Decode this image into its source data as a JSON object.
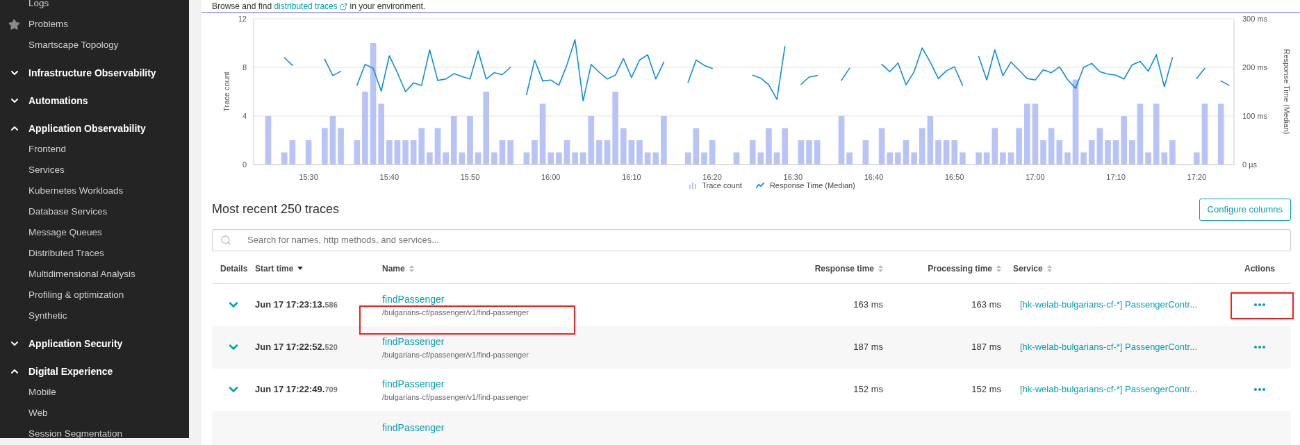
{
  "sidebar": {
    "items": [
      {
        "kind": "link",
        "label": "Logs"
      },
      {
        "kind": "pinned",
        "label": "Problems"
      },
      {
        "kind": "link",
        "label": "Smartscape Topology"
      },
      {
        "kind": "section",
        "label": "Infrastructure Observability",
        "expanded": false
      },
      {
        "kind": "section",
        "label": "Automations",
        "expanded": false
      },
      {
        "kind": "section",
        "label": "Application Observability",
        "expanded": true,
        "children": [
          "Frontend",
          "Services",
          "Kubernetes Workloads",
          "Database Services",
          "Message Queues",
          "Distributed Traces",
          "Multidimensional Analysis",
          "Profiling & optimization",
          "Synthetic"
        ]
      },
      {
        "kind": "section",
        "label": "Application Security",
        "expanded": false
      },
      {
        "kind": "section",
        "label": "Digital Experience",
        "expanded": true,
        "children": [
          "Mobile",
          "Web",
          "Session Segmentation"
        ]
      }
    ]
  },
  "intro": {
    "before": "Browse and find",
    "link": "distributed traces",
    "after": "in your environment."
  },
  "trace_count": {
    "chart_data": {
      "type": "bar",
      "ylabel": "Trace count",
      "ylim": [
        0,
        12
      ],
      "yticks": [
        0,
        4,
        8,
        12
      ],
      "categories": [
        null,
        null,
        null,
        null,
        null,
        "15:30",
        null,
        null,
        null,
        null,
        null,
        null,
        null,
        null,
        null,
        "15:40",
        null,
        null,
        null,
        null,
        null,
        null,
        null,
        null,
        null,
        "15:50",
        null,
        null,
        null,
        null,
        null,
        null,
        null,
        null,
        null,
        "16:00",
        null,
        null,
        null,
        null,
        null,
        null,
        null,
        null,
        null,
        "16:10",
        null,
        null,
        null,
        null,
        null,
        null,
        null,
        null,
        null,
        "16:20",
        null,
        null,
        null,
        null,
        null,
        null,
        null,
        null,
        null,
        "16:30",
        null,
        null,
        null,
        null,
        null,
        null,
        null,
        null,
        null,
        "16:40",
        null,
        null,
        null,
        null,
        null,
        null,
        null,
        null,
        null,
        "16:50",
        null,
        null,
        null,
        null,
        null,
        null,
        null,
        null,
        null,
        "17:00",
        null,
        null,
        null,
        null,
        null,
        null,
        null,
        null,
        null,
        "17:10",
        null,
        null,
        null,
        null,
        null,
        null,
        null,
        null,
        null,
        "17:20",
        null,
        null,
        null,
        null
      ],
      "series": [
        {
          "name": "Trace count",
          "color": "#b8c3f8",
          "values": [
            4,
            null,
            1,
            2,
            null,
            2,
            null,
            3,
            4,
            3,
            null,
            2,
            6,
            10,
            5,
            2,
            2,
            2,
            2,
            3,
            1,
            3,
            1,
            4,
            1,
            4,
            1,
            6,
            1,
            2,
            2,
            null,
            1,
            2,
            5,
            1,
            1,
            2,
            1,
            1,
            4,
            2,
            2,
            6,
            3,
            2,
            2,
            1,
            1,
            4,
            null,
            null,
            1,
            3,
            1,
            2,
            null,
            null,
            1,
            null,
            2,
            1,
            3,
            1,
            3,
            null,
            2,
            2,
            2,
            null,
            null,
            4,
            1,
            null,
            2,
            null,
            3,
            1,
            1,
            2,
            1,
            3,
            4,
            2,
            2,
            2,
            1,
            null,
            1,
            1,
            3,
            1,
            1,
            3,
            5,
            5,
            2,
            3,
            2,
            1,
            7,
            1,
            2,
            3,
            2,
            2,
            4,
            2,
            5,
            1,
            5,
            1,
            2,
            null,
            null,
            1,
            5,
            null,
            5,
            null
          ]
        }
      ]
    }
  },
  "response_time": {
    "chart_data": {
      "type": "line",
      "ylabel": "Response Time (Median)",
      "ylim": [
        0,
        300
      ],
      "yticks": [
        {
          "value": 0,
          "label": "0 µs"
        },
        {
          "value": 100,
          "label": "100 ms"
        },
        {
          "value": 200,
          "label": "200 ms"
        },
        {
          "value": 300,
          "label": "300 ms"
        }
      ],
      "categories": [
        null,
        null,
        null,
        null,
        null,
        null,
        null,
        null,
        null,
        null,
        null,
        null,
        null,
        null,
        null,
        null,
        null,
        null,
        null,
        null,
        null,
        null,
        null,
        null,
        null,
        null,
        null,
        null,
        null,
        null,
        null,
        null,
        null,
        null,
        null,
        null,
        null,
        null,
        null,
        null,
        null,
        null,
        null,
        null,
        null,
        null,
        null,
        null,
        null,
        null,
        null,
        null,
        null,
        null,
        null,
        null,
        null,
        null,
        null,
        null,
        null,
        null,
        null,
        null,
        null,
        null,
        null,
        null,
        null,
        null,
        null,
        null,
        null,
        null,
        null,
        null,
        null,
        null,
        null,
        null,
        null,
        null,
        null,
        null,
        null,
        null,
        null,
        null,
        null,
        null,
        null,
        null,
        null,
        null,
        null,
        null,
        null,
        null,
        null,
        null,
        null,
        null,
        null,
        null,
        null,
        null,
        null,
        null,
        null,
        null,
        null,
        null,
        null,
        null,
        null,
        null,
        null,
        null,
        null,
        null
      ],
      "series": [
        {
          "name": "Response Time (Median)",
          "color": "#0b8fdc",
          "values": [
            null,
            null,
            220,
            204,
            null,
            null,
            null,
            217,
            183,
            192,
            null,
            163,
            206,
            198,
            151,
            224,
            189,
            150,
            168,
            163,
            236,
            173,
            176,
            187,
            181,
            176,
            234,
            176,
            189,
            185,
            200,
            null,
            144,
            215,
            172,
            174,
            163,
            205,
            257,
            131,
            206,
            190,
            176,
            184,
            218,
            179,
            215,
            226,
            176,
            211,
            null,
            null,
            169,
            215,
            204,
            198,
            null,
            null,
            null,
            null,
            184,
            178,
            164,
            134,
            243,
            null,
            165,
            180,
            183,
            null,
            null,
            173,
            198,
            null,
            null,
            null,
            206,
            191,
            209,
            164,
            191,
            240,
            211,
            177,
            193,
            201,
            163,
            null,
            222,
            174,
            236,
            183,
            211,
            194,
            177,
            174,
            195,
            189,
            201,
            175,
            157,
            200,
            208,
            191,
            186,
            184,
            176,
            205,
            212,
            192,
            226,
            160,
            220,
            null,
            null,
            177,
            198,
            null,
            172,
            163
          ]
        }
      ]
    }
  },
  "traces": {
    "title": "Most recent 250 traces",
    "configure_button": "Configure columns",
    "search": {
      "placeholder": "Search for names, http methods, and services..."
    },
    "columns": [
      {
        "label": "Details",
        "sortable": false
      },
      {
        "label": "Start time",
        "sortable": true,
        "sorted": true
      },
      {
        "label": "Name",
        "sortable": true,
        "sorted": false
      },
      {
        "label": "Response time",
        "sortable": true,
        "sorted": false
      },
      {
        "label": "Processing time",
        "sortable": true,
        "sorted": false
      },
      {
        "label": "Service",
        "sortable": true,
        "sorted": false
      },
      {
        "label": "Actions",
        "sortable": false
      }
    ],
    "rows": [
      {
        "kind": "full",
        "expanded": false,
        "highlighted": true,
        "start": "Jun 17 17:23:13.",
        "ms": "586",
        "name": "findPassenger",
        "path": "/bulgarians-cf/passenger/v1/find-passenger",
        "response": "163 ms",
        "processing": "163 ms",
        "service": "[hk-welab-bulgarians-cf-*] PassengerContr..."
      },
      {
        "kind": "full",
        "expanded": false,
        "highlighted": false,
        "start": "Jun 17 17:22:52.",
        "ms": "520",
        "name": "findPassenger",
        "path": "/bulgarians-cf/passenger/v1/find-passenger",
        "response": "187 ms",
        "processing": "187 ms",
        "service": "[hk-welab-bulgarians-cf-*] PassengerContr..."
      },
      {
        "kind": "full",
        "expanded": false,
        "highlighted": false,
        "start": "Jun 17 17:22:49.",
        "ms": "709",
        "name": "findPassenger",
        "path": "/bulgarians-cf/passenger/v1/find-passenger",
        "response": "152 ms",
        "processing": "152 ms",
        "service": "[hk-welab-bulgarians-cf-*] PassengerContr..."
      },
      {
        "kind": "partial",
        "name": "findPassenger"
      }
    ]
  }
}
